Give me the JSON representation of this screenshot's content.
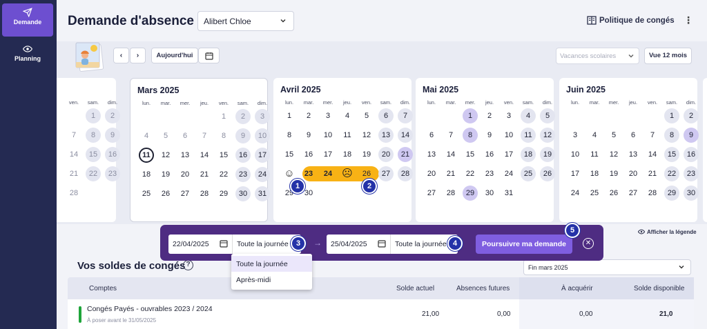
{
  "nav": {
    "items": [
      {
        "label": "Demande",
        "icon": "send-icon"
      },
      {
        "label": "Planning",
        "icon": "eye-icon"
      }
    ]
  },
  "header": {
    "title": "Demande d'absence",
    "employee": "Alibert Chloe",
    "policy_link": "Politique de congés"
  },
  "toolbar": {
    "today": "Aujourd'hui",
    "school_placeholder": "Vacances scolaires",
    "view_12": "Vue 12 mois"
  },
  "calendar": {
    "weekday_labels": [
      "lun.",
      "mar.",
      "mer.",
      "jeu.",
      "ven.",
      "sam.",
      "dim."
    ],
    "partial_prev": {
      "weekday_labels": [
        "ven.",
        "sam.",
        "dim."
      ],
      "rows": [
        [
          "",
          "1",
          "2"
        ],
        [
          "7",
          "8",
          "9"
        ],
        [
          "14",
          "15",
          "16"
        ],
        [
          "21",
          "22",
          "23"
        ],
        [
          "28",
          "",
          ""
        ]
      ]
    },
    "months": [
      {
        "title": "Mars 2025",
        "first_dow": 5,
        "days": 31
      },
      {
        "title": "Avril 2025",
        "first_dow": 1,
        "days": 30
      },
      {
        "title": "Mai 2025",
        "first_dow": 3,
        "days": 31
      },
      {
        "title": "Juin 2025",
        "first_dow": 6,
        "days": 30
      }
    ],
    "today": "11",
    "highlighted": {
      "Avril 2025": [
        "21"
      ],
      "Mai 2025": [
        "1",
        "8",
        "29"
      ],
      "Juin 2025": [
        "9"
      ]
    },
    "leave_start": "21",
    "leave_end": "25",
    "badges": [
      "1",
      "2"
    ],
    "legend_link": "Afficher la légende"
  },
  "range": {
    "start_date": "22/04/2025",
    "start_period": "Toute la journée",
    "end_date": "25/04/2025",
    "end_period": "Toute la journée",
    "continue": "Poursuivre ma demande",
    "badges": [
      "3",
      "4",
      "5"
    ]
  },
  "dropdown": {
    "options": [
      "Toute la journée",
      "Après-midi"
    ]
  },
  "balances": {
    "title": "Vos soldes de congés",
    "period": "Fin mars 2025",
    "columns": [
      "Comptes",
      "Solde actuel",
      "Absences futures",
      "À acquérir",
      "Solde disponible"
    ],
    "rows": [
      {
        "name": "Congés Payés - ouvrables 2023 / 2024",
        "sub": "À poser avant le 31/05/2025",
        "current": "21,00",
        "future": "0,00",
        "acquire": "0,00",
        "available": "21,0"
      }
    ]
  },
  "colors": {
    "sidebar": "#242a52",
    "accent": "#7f5ee0",
    "leave": "#f8b215",
    "range_bar": "#4e2c82"
  }
}
